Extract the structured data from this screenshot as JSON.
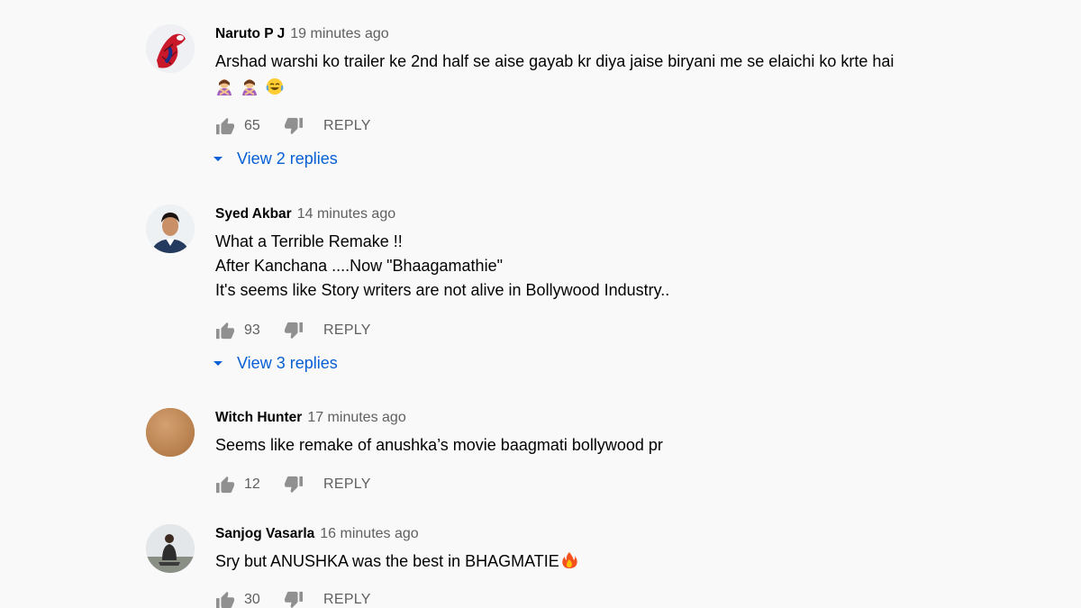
{
  "reply_label": "REPLY",
  "comments": [
    {
      "author": "Naruto P J",
      "time": "19 minutes ago",
      "lines": [
        "Arshad warshi ko trailer ke 2nd half se aise gayab kr diya jaise biryani me se elaichi ko krte hai"
      ],
      "emojis": [
        "woman-gesturing-no-emoji",
        "woman-gesturing-no-emoji",
        "face-with-tears-of-joy-emoji"
      ],
      "likes": "65",
      "view_replies": "View 2 replies",
      "avatar": "spiderman-avatar"
    },
    {
      "author": "Syed Akbar",
      "time": "14 minutes ago",
      "lines": [
        "What a Terrible Remake !!",
        "After Kanchana ....Now \"Bhaagamathie\"",
        "It's seems like Story writers are not alive in Bollywood Industry.."
      ],
      "likes": "93",
      "view_replies": "View 3 replies",
      "avatar": "man-photo-avatar"
    },
    {
      "author": "Witch Hunter",
      "time": "17 minutes ago",
      "lines": [
        "Seems like remake of anushka’s movie baagmati bollywood pr"
      ],
      "likes": "12",
      "avatar": "brown-circle-avatar"
    },
    {
      "author": "Sanjog Vasarla",
      "time": "16 minutes ago",
      "lines": [
        "Sry but ANUSHKA was the best in BHAGMATIE"
      ],
      "trailing_emoji": "fire-emoji",
      "likes": "30",
      "avatar": "man-sitting-avatar"
    }
  ],
  "colors": {
    "background": "#f9f9f9",
    "link": "#065fd4",
    "meta": "#606060",
    "text": "#030303"
  }
}
